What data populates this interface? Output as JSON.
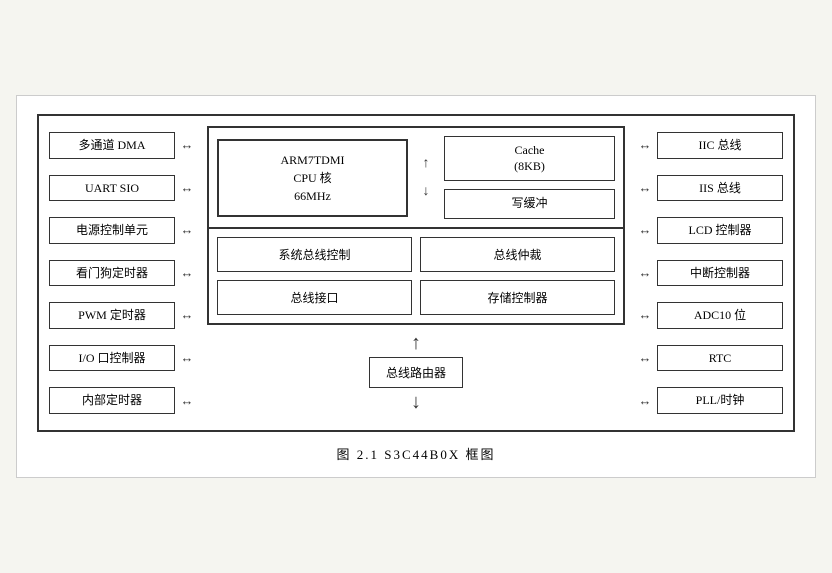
{
  "caption": "图 2.1   S3C44B0X 框图",
  "left_items": [
    "多通道 DMA",
    "UART  SIO",
    "电源控制单元",
    "看门狗定时器",
    "PWM 定时器",
    "I/O 口控制器",
    "内部定时器"
  ],
  "right_items": [
    "IIC 总线",
    "IIS 总线",
    "LCD 控制器",
    "中断控制器",
    "ADC10 位",
    "RTC",
    "PLL/时钟"
  ],
  "cpu_label": "ARM7TDMI\nCPU 核\n66MHz",
  "cache_label": "Cache\n(8KB)",
  "write_buffer_label": "写缓冲",
  "router_label": "总线路由器",
  "bottom_blocks": [
    "系统总线控制",
    "总线仲裁",
    "总线接口",
    "存储控制器"
  ],
  "arrow_lr": "↔",
  "arrow_ud": "↕",
  "arrow_up": "↑",
  "arrow_down": "↓"
}
